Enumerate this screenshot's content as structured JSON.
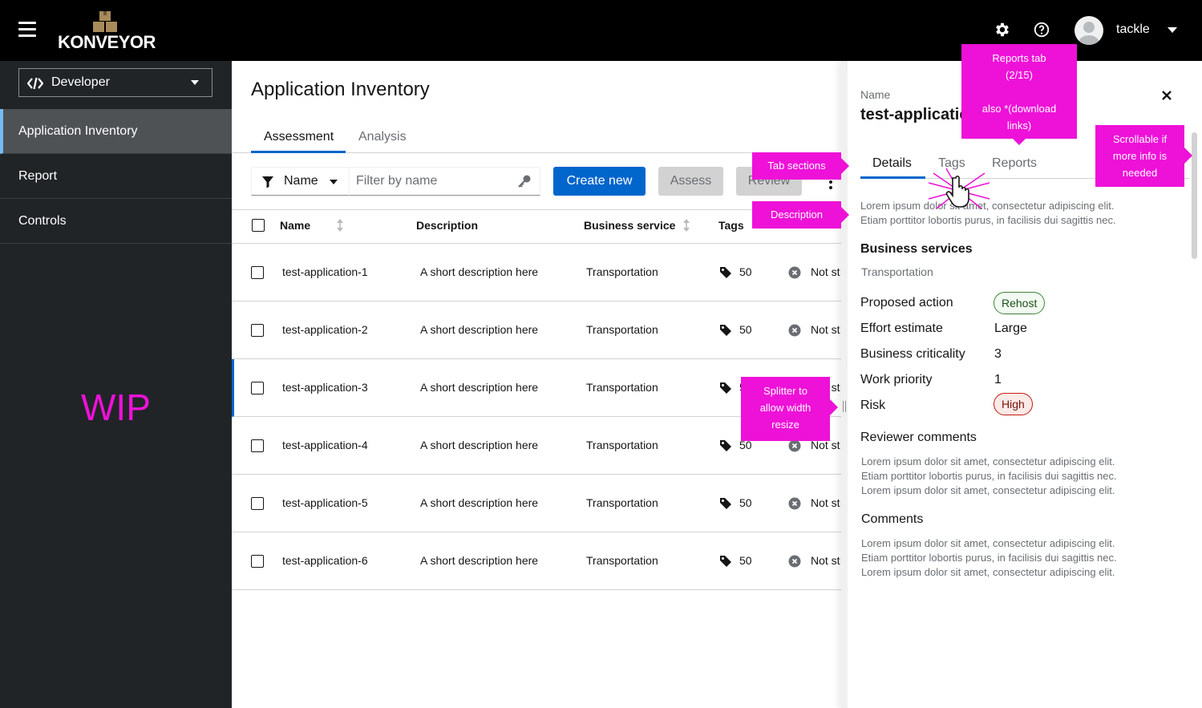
{
  "header": {
    "logo_text": "KONVEYOR",
    "username": "tackle",
    "icons": [
      "menu-icon",
      "gear-icon",
      "help-icon",
      "avatar-icon",
      "caret-down-icon"
    ]
  },
  "sidebar": {
    "perspective": "Developer",
    "items": [
      {
        "label": "Application Inventory",
        "active": true
      },
      {
        "label": "Report",
        "active": false
      },
      {
        "label": "Controls",
        "active": false
      }
    ],
    "wip": "WIP"
  },
  "main": {
    "title": "Application Inventory",
    "tabs": [
      {
        "label": "Assessment",
        "active": true
      },
      {
        "label": "Analysis",
        "active": false
      }
    ],
    "toolbar": {
      "filter_label": "Name",
      "filter_placeholder": "Filter by name",
      "create_label": "Create new",
      "assess_label": "Assess",
      "review_label": "Review"
    },
    "columns": [
      "Name",
      "Description",
      "Business service",
      "Tags"
    ],
    "rows": [
      {
        "name": "test-application-1",
        "description": "A short description here",
        "service": "Transportation",
        "tags": "50",
        "status": "Not st"
      },
      {
        "name": "test-application-2",
        "description": "A short description here",
        "service": "Transportation",
        "tags": "50",
        "status": "Not st"
      },
      {
        "name": "test-application-3",
        "description": "A short description here",
        "service": "Transportation",
        "tags": "50",
        "status": "Not st"
      },
      {
        "name": "test-application-4",
        "description": "A short description here",
        "service": "Transportation",
        "tags": "50",
        "status": "Not st"
      },
      {
        "name": "test-application-5",
        "description": "A short description here",
        "service": "Transportation",
        "tags": "50",
        "status": "Not st"
      },
      {
        "name": "test-application-6",
        "description": "A short description here",
        "service": "Transportation",
        "tags": "50",
        "status": "Not st"
      }
    ]
  },
  "drawer": {
    "name_label": "Name",
    "name": "test-applicatio",
    "tabs": [
      "Details",
      "Tags",
      "Reports"
    ],
    "description_1": "Lorem ipsum dolor sit amet, consectetur adipiscing elit.",
    "description_2": "Etiam porttitor lobortis purus, in facilisis dui sagittis nec.",
    "business_services_heading": "Business services",
    "business_service_value": "Transportation",
    "proposed_action_label": "Proposed action",
    "proposed_action_value": "Rehost",
    "effort_label": "Effort estimate",
    "effort_value": "Large",
    "criticality_label": "Business criticality",
    "criticality_value": "3",
    "priority_label": "Work priority",
    "priority_value": "1",
    "risk_label": "Risk",
    "risk_value": "High",
    "reviewer_heading": "Reviewer comments",
    "reviewer_1": "Lorem ipsum dolor sit amet, consectetur adipiscing elit.",
    "reviewer_2": "Etiam porttitor lobortis purus, in facilisis dui sagittis nec.",
    "reviewer_3": "Lorem ipsum dolor sit amet, consectetur adipiscing elit.",
    "comments_heading": "Comments",
    "comments_1": "Lorem ipsum dolor sit amet, consectetur adipiscing elit.",
    "comments_2": "Etiam porttitor lobortis purus, in facilisis dui sagittis nec.",
    "comments_3": "Lorem ipsum dolor sit amet, consectetur adipiscing elit."
  },
  "annotations": {
    "reports_tab_1": "Reports tab",
    "reports_tab_2": "(2/15)",
    "reports_tab_3": "also *(download",
    "reports_tab_4": "links)",
    "scrollable_1": "Scrollable if",
    "scrollable_2": "more info is",
    "scrollable_3": "needed",
    "tab_sections": "Tab sections",
    "description": "Description",
    "splitter_1": "Splitter to",
    "splitter_2": "allow width",
    "splitter_3": "resize"
  },
  "colors": {
    "accent": "#0066cc",
    "annotation": "#ee11d8",
    "sidebar": "#212427",
    "header": "#000000"
  }
}
